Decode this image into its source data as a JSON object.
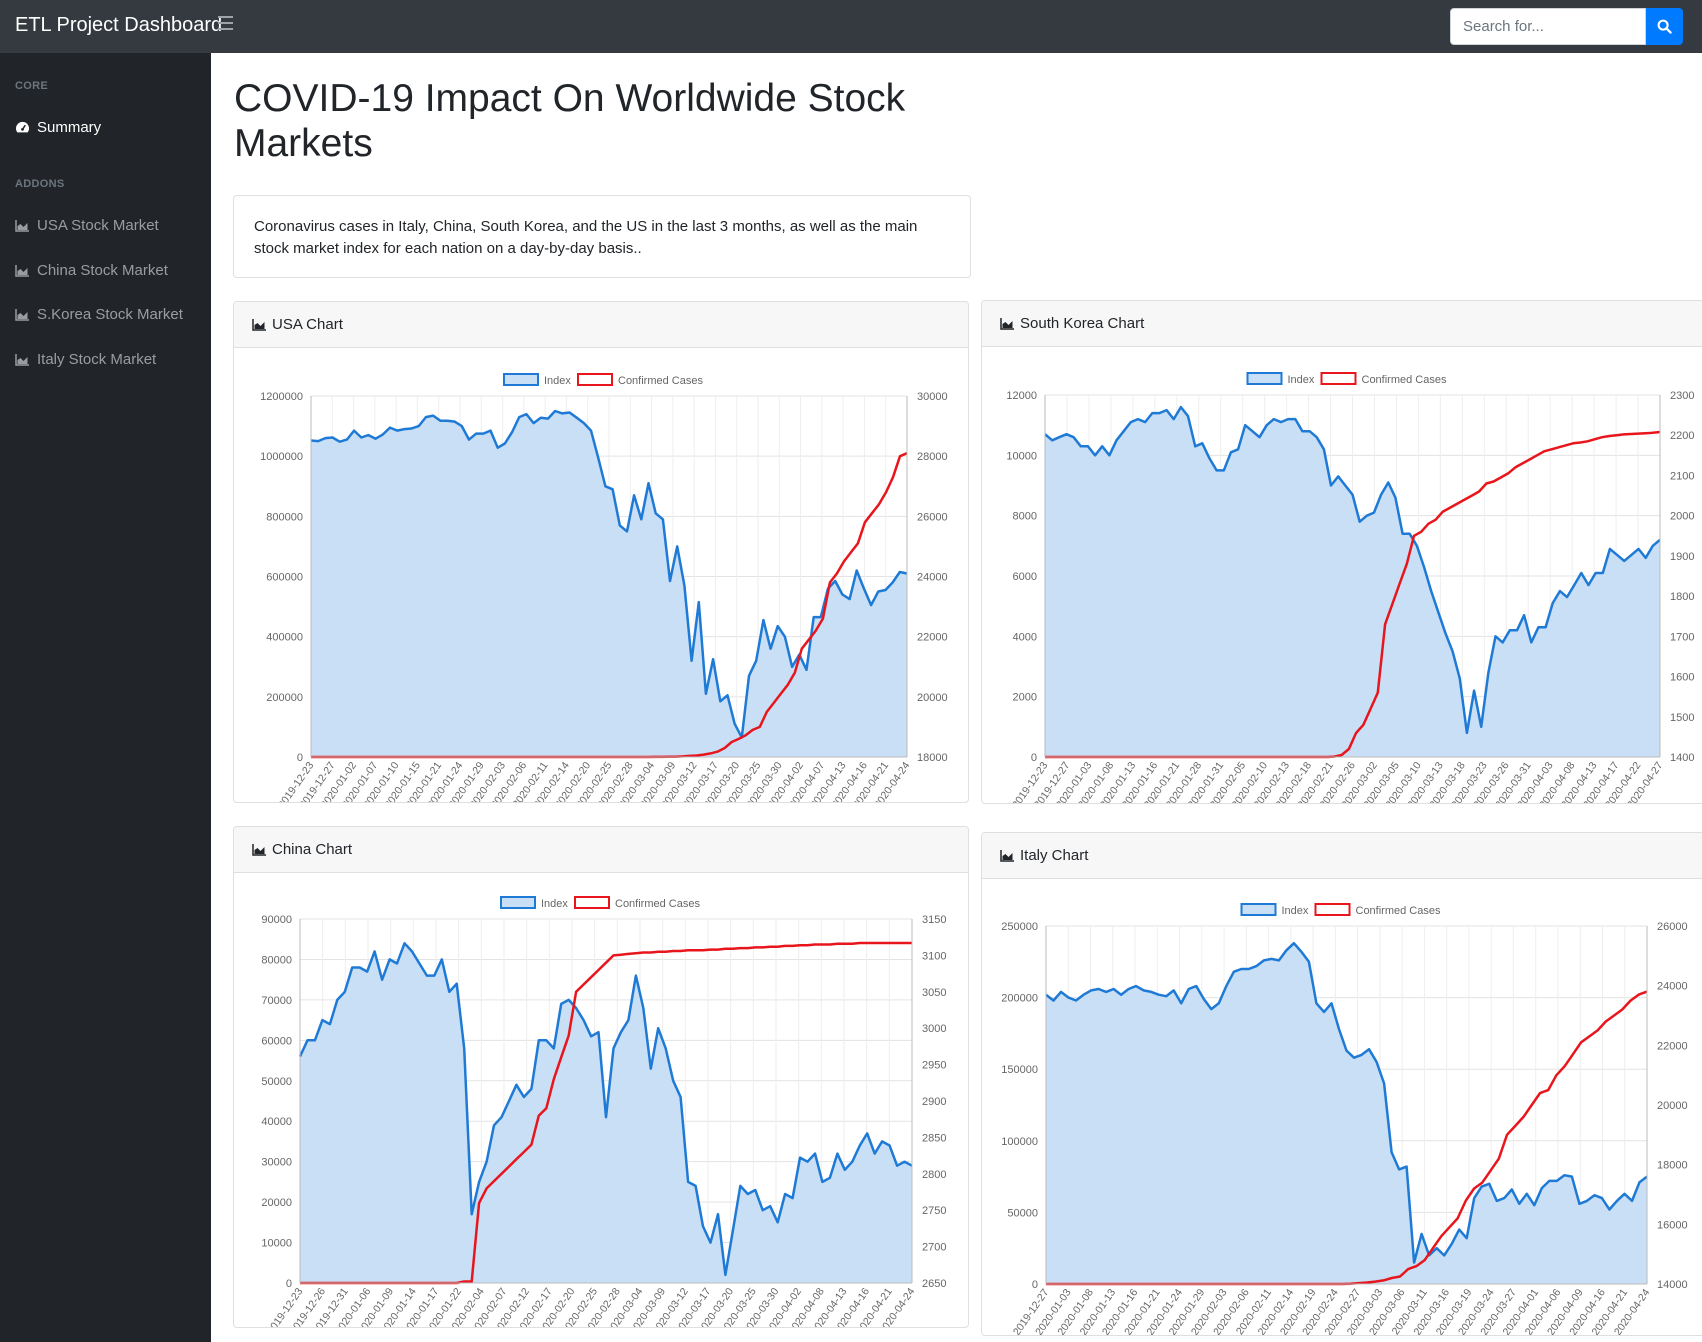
{
  "app": {
    "brand": "ETL Project Dashboard"
  },
  "search": {
    "placeholder": "Search for..."
  },
  "sidebar": {
    "core_heading": "CORE",
    "addons_heading": "ADDONS",
    "items": [
      {
        "label": "Summary",
        "icon": "tachometer-icon"
      },
      {
        "label": "USA Stock Market",
        "icon": "area-chart-icon"
      },
      {
        "label": "China Stock Market",
        "icon": "area-chart-icon"
      },
      {
        "label": "S.Korea Stock Market",
        "icon": "area-chart-icon"
      },
      {
        "label": "Italy Stock Market",
        "icon": "area-chart-icon"
      }
    ]
  },
  "main": {
    "title": "COVID-19 Impact On Worldwide Stock Markets",
    "description": "Coronavirus cases in Italy, China, South Korea, and the US in the last 3 months, as well as the main stock market index for each nation on a day-by-day basis.."
  },
  "colors": {
    "index_line": "#1f7ad6",
    "index_fill": "#c8dff5",
    "cases_line": "#e8161c",
    "topbar": "#343a40",
    "sidebar": "#212529",
    "accent": "#007bff"
  },
  "chart_data": [
    {
      "id": "usa",
      "card_title": "USA Chart",
      "type": "line",
      "legend": [
        "Index",
        "Confirmed Cases"
      ],
      "legend_position": "top",
      "grid": true,
      "y_left": {
        "min": 0,
        "max": 1200000,
        "ticks": [
          "0",
          "200000",
          "400000",
          "600000",
          "800000",
          "1000000",
          "1200000"
        ]
      },
      "y_right": {
        "min": 18000,
        "max": 30000,
        "ticks": [
          "18000",
          "20000",
          "22000",
          "24000",
          "26000",
          "28000",
          "30000"
        ]
      },
      "x_labels": [
        "2019-12-23",
        "2019-12-27",
        "2020-01-02",
        "2020-01-07",
        "2020-01-10",
        "2020-01-15",
        "2020-01-21",
        "2020-01-24",
        "2020-01-29",
        "2020-02-03",
        "2020-02-06",
        "2020-02-11",
        "2020-02-14",
        "2020-02-20",
        "2020-02-25",
        "2020-02-28",
        "2020-03-04",
        "2020-03-09",
        "2020-03-12",
        "2020-03-17",
        "2020-03-20",
        "2020-03-25",
        "2020-03-30",
        "2020-04-02",
        "2020-04-07",
        "2020-04-13",
        "2020-04-16",
        "2020-04-21",
        "2020-04-24"
      ],
      "series": [
        {
          "name": "Index",
          "values": [
            1052000,
            1050000,
            1060000,
            1062000,
            1048000,
            1055000,
            1085000,
            1062000,
            1070000,
            1058000,
            1072000,
            1095000,
            1085000,
            1090000,
            1092000,
            1100000,
            1130000,
            1135000,
            1118000,
            1118000,
            1115000,
            1100000,
            1055000,
            1075000,
            1075000,
            1085000,
            1028000,
            1042000,
            1080000,
            1130000,
            1140000,
            1110000,
            1128000,
            1125000,
            1150000,
            1142000,
            1145000,
            1128000,
            1110000,
            1085000,
            995000,
            900000,
            890000,
            770000,
            750000,
            870000,
            790000,
            910000,
            810000,
            790000,
            585000,
            700000,
            570000,
            320000,
            515000,
            210000,
            325000,
            185000,
            205000,
            110000,
            65000,
            270000,
            320000,
            455000,
            360000,
            435000,
            400000,
            300000,
            340000,
            290000,
            465000,
            465000,
            560000,
            585000,
            540000,
            525000,
            620000,
            560000,
            505000,
            550000,
            555000,
            580000,
            615000,
            610000
          ]
        },
        {
          "name": "Confirmed Cases",
          "values": [
            18000,
            18000,
            18000,
            18000,
            18000,
            18000,
            18000,
            18000,
            18000,
            18000,
            18000,
            18000,
            18000,
            18000,
            18000,
            18000,
            18000,
            18000,
            18000,
            18000,
            18000,
            18000,
            18000,
            18000,
            18000,
            18000,
            18000,
            18000,
            18000,
            18000,
            18000,
            18000,
            18000,
            18000,
            18000,
            18000,
            18000,
            18000,
            18000,
            18000,
            18000,
            18000,
            18000,
            18000,
            18000,
            18000,
            18000,
            18000,
            18001,
            18002,
            18003,
            18005,
            18010,
            18020,
            18035,
            18050,
            18080,
            18120,
            18180,
            18300,
            18500,
            18600,
            18720,
            18900,
            19000,
            19500,
            19800,
            20100,
            20400,
            20800,
            21600,
            21900,
            22200,
            22600,
            23800,
            24100,
            24500,
            24800,
            25100,
            25800,
            26100,
            26400,
            26800,
            27300,
            28000,
            28100
          ]
        }
      ]
    },
    {
      "id": "korea",
      "card_title": "South Korea Chart",
      "type": "line",
      "legend": [
        "Index",
        "Confirmed Cases"
      ],
      "legend_position": "top",
      "grid": true,
      "y_left": {
        "min": 0,
        "max": 12000,
        "ticks": [
          "0",
          "2000",
          "4000",
          "6000",
          "8000",
          "10000",
          "12000"
        ]
      },
      "y_right": {
        "min": 1400,
        "max": 2300,
        "ticks": [
          "1400",
          "1500",
          "1600",
          "1700",
          "1800",
          "1900",
          "2000",
          "2100",
          "2200",
          "2300"
        ]
      },
      "x_labels": [
        "2019-12-23",
        "2019-12-27",
        "2020-01-03",
        "2020-01-08",
        "2020-01-13",
        "2020-01-16",
        "2020-01-21",
        "2020-01-28",
        "2020-01-31",
        "2020-02-05",
        "2020-02-10",
        "2020-02-13",
        "2020-02-18",
        "2020-02-21",
        "2020-02-26",
        "2020-03-02",
        "2020-03-05",
        "2020-03-10",
        "2020-03-13",
        "2020-03-18",
        "2020-03-23",
        "2020-03-26",
        "2020-03-31",
        "2020-04-03",
        "2020-04-08",
        "2020-04-13",
        "2020-04-17",
        "2020-04-22",
        "2020-04-27"
      ],
      "series": [
        {
          "name": "Index",
          "values": [
            10700,
            10500,
            10600,
            10700,
            10600,
            10300,
            10300,
            10000,
            10300,
            10000,
            10500,
            10800,
            11100,
            11200,
            11100,
            11400,
            11400,
            11500,
            11200,
            11600,
            11300,
            10300,
            10400,
            9900,
            9500,
            9500,
            10100,
            10200,
            11000,
            10800,
            10600,
            11000,
            11200,
            11100,
            11200,
            11200,
            10800,
            10800,
            10600,
            10200,
            9000,
            9300,
            9000,
            8700,
            7800,
            8000,
            8100,
            8700,
            9100,
            8600,
            7400,
            7400,
            7000,
            6300,
            5500,
            4800,
            4100,
            3500,
            2600,
            800,
            2200,
            1000,
            2800,
            4000,
            3800,
            4200,
            4200,
            4700,
            3800,
            4300,
            4300,
            5100,
            5500,
            5300,
            5700,
            6100,
            5700,
            6100,
            6100,
            6900,
            6700,
            6500,
            6700,
            6900,
            6600,
            7000,
            7200
          ]
        },
        {
          "name": "Confirmed Cases",
          "values": [
            1400,
            1400,
            1400,
            1400,
            1400,
            1400,
            1400,
            1400,
            1400,
            1400,
            1400,
            1400,
            1400,
            1400,
            1400,
            1400,
            1400,
            1400,
            1400,
            1400,
            1400,
            1400,
            1400,
            1400,
            1400,
            1400,
            1400,
            1400,
            1400,
            1400,
            1400,
            1400,
            1400,
            1400,
            1400,
            1400,
            1400,
            1400,
            1400,
            1400,
            1401,
            1405,
            1420,
            1460,
            1480,
            1520,
            1560,
            1730,
            1780,
            1830,
            1880,
            1950,
            1960,
            1980,
            1990,
            2010,
            2020,
            2030,
            2040,
            2050,
            2060,
            2080,
            2085,
            2095,
            2105,
            2120,
            2130,
            2140,
            2150,
            2160,
            2165,
            2170,
            2175,
            2180,
            2182,
            2185,
            2190,
            2195,
            2198,
            2200,
            2202,
            2203,
            2204,
            2205,
            2206,
            2208
          ]
        }
      ]
    },
    {
      "id": "china",
      "card_title": "China Chart",
      "type": "line",
      "legend": [
        "Index",
        "Confirmed Cases"
      ],
      "legend_position": "top",
      "grid": true,
      "y_left": {
        "min": 0,
        "max": 90000,
        "ticks": [
          "0",
          "10000",
          "20000",
          "30000",
          "40000",
          "50000",
          "60000",
          "70000",
          "80000",
          "90000"
        ]
      },
      "y_right": {
        "min": 2650,
        "max": 3150,
        "ticks": [
          "2650",
          "2700",
          "2750",
          "2800",
          "2850",
          "2900",
          "2950",
          "3000",
          "3050",
          "3100",
          "3150"
        ]
      },
      "x_labels": [
        "2019-12-23",
        "2019-12-26",
        "2019-12-31",
        "2020-01-06",
        "2020-01-09",
        "2020-01-14",
        "2020-01-17",
        "2020-01-22",
        "2020-02-04",
        "2020-02-07",
        "2020-02-12",
        "2020-02-17",
        "2020-02-20",
        "2020-02-25",
        "2020-02-28",
        "2020-03-04",
        "2020-03-09",
        "2020-03-12",
        "2020-03-17",
        "2020-03-20",
        "2020-03-25",
        "2020-03-30",
        "2020-04-02",
        "2020-04-08",
        "2020-04-13",
        "2020-04-16",
        "2020-04-21",
        "2020-04-24"
      ],
      "series": [
        {
          "name": "Index",
          "values": [
            56000,
            60000,
            60000,
            65000,
            64000,
            70000,
            72000,
            78000,
            78000,
            77000,
            82000,
            75000,
            80000,
            79000,
            84000,
            82000,
            79000,
            76000,
            76000,
            80000,
            72000,
            74000,
            58000,
            17000,
            25000,
            30000,
            39000,
            41000,
            45000,
            49000,
            46000,
            48000,
            60000,
            60000,
            58000,
            69000,
            70000,
            68000,
            65000,
            61000,
            62000,
            41000,
            58000,
            62000,
            65000,
            76000,
            68000,
            53000,
            63000,
            58000,
            50000,
            46000,
            25000,
            24000,
            14000,
            10000,
            17000,
            2000,
            13000,
            24000,
            22000,
            23000,
            18000,
            19000,
            15000,
            22000,
            21000,
            31000,
            30000,
            32000,
            25000,
            26000,
            32000,
            28000,
            30000,
            34000,
            37000,
            32000,
            35000,
            34000,
            29000,
            30000,
            29000
          ]
        },
        {
          "name": "Confirmed Cases",
          "values": [
            2650,
            2650,
            2650,
            2650,
            2650,
            2650,
            2650,
            2650,
            2650,
            2650,
            2650,
            2650,
            2650,
            2650,
            2650,
            2650,
            2650,
            2650,
            2650,
            2650,
            2650,
            2650,
            2652,
            2652,
            2760,
            2780,
            2790,
            2800,
            2810,
            2820,
            2830,
            2840,
            2880,
            2890,
            2930,
            2960,
            2990,
            3050,
            3060,
            3070,
            3080,
            3090,
            3100,
            3101,
            3102,
            3103,
            3104,
            3104,
            3105,
            3105,
            3106,
            3106,
            3107,
            3107,
            3107,
            3108,
            3108,
            3109,
            3109,
            3110,
            3110,
            3111,
            3111,
            3112,
            3112,
            3113,
            3113,
            3114,
            3114,
            3115,
            3115,
            3115,
            3116,
            3116,
            3116,
            3117,
            3117,
            3117,
            3117,
            3117,
            3117,
            3117,
            3117
          ]
        }
      ]
    },
    {
      "id": "italy",
      "card_title": "Italy Chart",
      "type": "line",
      "legend": [
        "Index",
        "Confirmed Cases"
      ],
      "legend_position": "top",
      "grid": true,
      "y_left": {
        "min": 0,
        "max": 250000,
        "ticks": [
          "0",
          "50000",
          "100000",
          "150000",
          "200000",
          "250000"
        ]
      },
      "y_right": {
        "min": 14000,
        "max": 26000,
        "ticks": [
          "14000",
          "16000",
          "18000",
          "20000",
          "22000",
          "24000",
          "26000"
        ]
      },
      "x_labels": [
        "2019-12-27",
        "2020-01-03",
        "2020-01-08",
        "2020-01-13",
        "2020-01-16",
        "2020-01-21",
        "2020-01-24",
        "2020-01-29",
        "2020-02-03",
        "2020-02-06",
        "2020-02-11",
        "2020-02-14",
        "2020-02-19",
        "2020-02-24",
        "2020-02-27",
        "2020-03-03",
        "2020-03-06",
        "2020-03-11",
        "2020-03-16",
        "2020-03-19",
        "2020-03-24",
        "2020-03-27",
        "2020-04-01",
        "2020-04-06",
        "2020-04-09",
        "2020-04-16",
        "2020-04-21",
        "2020-04-24"
      ],
      "series": [
        {
          "name": "Index",
          "values": [
            202000,
            198000,
            204000,
            200000,
            198000,
            202000,
            205000,
            206000,
            204000,
            206000,
            202000,
            206000,
            208000,
            205000,
            204000,
            202000,
            201000,
            205000,
            196000,
            206000,
            208000,
            199000,
            192000,
            196000,
            208000,
            218000,
            220000,
            220000,
            222000,
            226000,
            227000,
            226000,
            233000,
            238000,
            232000,
            225000,
            196000,
            190000,
            196000,
            178000,
            163000,
            158000,
            160000,
            164000,
            155000,
            140000,
            92000,
            80000,
            82000,
            15000,
            35000,
            20000,
            25000,
            20000,
            28000,
            38000,
            32000,
            60000,
            68000,
            70000,
            58000,
            60000,
            66000,
            56000,
            63000,
            55000,
            67000,
            72000,
            72000,
            76000,
            75000,
            56000,
            58000,
            62000,
            60000,
            52000,
            58000,
            63000,
            58000,
            71000,
            75000
          ]
        },
        {
          "name": "Confirmed Cases",
          "values": [
            14000,
            14000,
            14000,
            14000,
            14000,
            14000,
            14000,
            14000,
            14000,
            14000,
            14000,
            14000,
            14000,
            14000,
            14000,
            14000,
            14000,
            14000,
            14000,
            14000,
            14000,
            14000,
            14000,
            14000,
            14000,
            14000,
            14000,
            14000,
            14000,
            14000,
            14000,
            14000,
            14000,
            14000,
            14000,
            14000,
            14000,
            14010,
            14030,
            14050,
            14080,
            14120,
            14200,
            14250,
            14500,
            14600,
            14800,
            15200,
            15600,
            15900,
            16200,
            16800,
            17200,
            17400,
            17800,
            18200,
            19000,
            19300,
            19600,
            20000,
            20400,
            20500,
            21000,
            21300,
            21700,
            22100,
            22300,
            22500,
            22800,
            23000,
            23200,
            23500,
            23700,
            23800
          ]
        }
      ]
    }
  ]
}
